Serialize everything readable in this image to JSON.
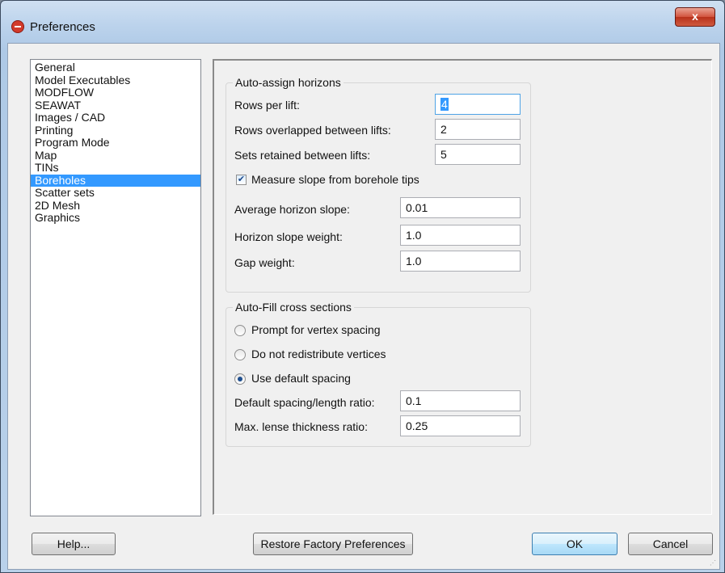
{
  "window": {
    "title": "Preferences",
    "close_label": "x"
  },
  "sidebar": {
    "items": [
      {
        "label": "General",
        "selected": false
      },
      {
        "label": "Model Executables",
        "selected": false
      },
      {
        "label": "MODFLOW",
        "selected": false
      },
      {
        "label": "SEAWAT",
        "selected": false
      },
      {
        "label": "Images / CAD",
        "selected": false
      },
      {
        "label": "Printing",
        "selected": false
      },
      {
        "label": "Program Mode",
        "selected": false
      },
      {
        "label": "Map",
        "selected": false
      },
      {
        "label": "TINs",
        "selected": false
      },
      {
        "label": "Boreholes",
        "selected": true
      },
      {
        "label": "Scatter sets",
        "selected": false
      },
      {
        "label": "2D Mesh",
        "selected": false
      },
      {
        "label": "Graphics",
        "selected": false
      }
    ]
  },
  "auto_assign": {
    "title": "Auto-assign horizons",
    "rows_per_lift": {
      "label": "Rows per lift:",
      "value": "4"
    },
    "rows_overlapped": {
      "label": "Rows overlapped between lifts:",
      "value": "2"
    },
    "sets_retained": {
      "label": "Sets retained between lifts:",
      "value": "5"
    },
    "measure_slope": {
      "label": "Measure slope from borehole tips",
      "checked": true
    },
    "avg_slope": {
      "label": "Average horizon slope:",
      "value": "0.01"
    },
    "slope_weight": {
      "label": "Horizon slope weight:",
      "value": "1.0"
    },
    "gap_weight": {
      "label": "Gap weight:",
      "value": "1.0"
    }
  },
  "auto_fill": {
    "title": "Auto-Fill cross sections",
    "radios": [
      {
        "label": "Prompt for vertex spacing",
        "selected": false
      },
      {
        "label": "Do not redistribute vertices",
        "selected": false
      },
      {
        "label": "Use default spacing",
        "selected": true
      }
    ],
    "default_spacing": {
      "label": "Default spacing/length ratio:",
      "value": "0.1"
    },
    "lense_thickness": {
      "label": "Max. lense thickness ratio:",
      "value": "0.25"
    }
  },
  "buttons": {
    "help": "Help...",
    "restore": "Restore Factory Preferences",
    "ok": "OK",
    "cancel": "Cancel"
  }
}
